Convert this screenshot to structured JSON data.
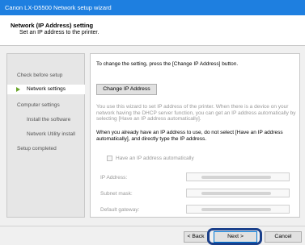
{
  "window": {
    "title": "Canon LX-D5500 Network setup wizard"
  },
  "header": {
    "title": "Network (IP Address) setting",
    "subtitle": "Set an IP address to the printer."
  },
  "sidebar": {
    "items": [
      {
        "label": "Check before setup"
      },
      {
        "label": "Network settings"
      },
      {
        "label": "Computer settings"
      },
      {
        "label": "Install the software"
      },
      {
        "label": "Network Utility install"
      },
      {
        "label": "Setup completed"
      }
    ]
  },
  "main": {
    "intro": "To change the setting, press the [Change IP Address] button.",
    "change_ip_button": "Change IP Address",
    "info_gray": "You use this wizard to set IP address of the printer. When there is a device on your network having the DHCP server function, you can get an IP address automatically by selecting [Have an IP address automatically].",
    "info_black": "When you already have an IP address to use, do not select [Have an IP address automatically], and directly type the IP address.",
    "auto_ip_checkbox": {
      "label": "Have an IP address automatically",
      "checked": false
    },
    "fields": [
      {
        "label": "IP Address:"
      },
      {
        "label": "Subnet mask:"
      },
      {
        "label": "Default gateway:"
      }
    ]
  },
  "footer": {
    "back": "< Back",
    "next": "Next >",
    "cancel": "Cancel"
  },
  "colors": {
    "titlebar": "#1e7fe0",
    "highlight": "#1a3f8a",
    "arrow": "#6aa52b"
  }
}
